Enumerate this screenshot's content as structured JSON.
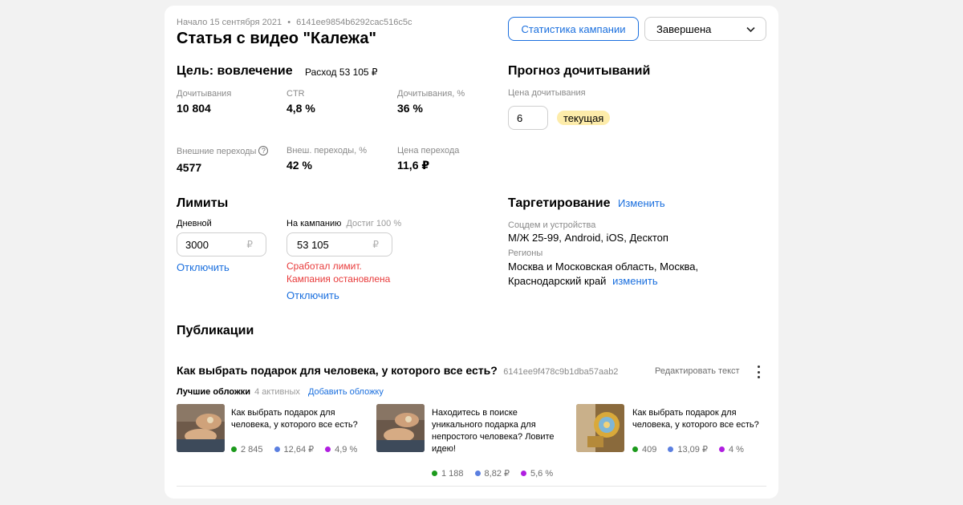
{
  "header": {
    "meta_date": "Начало 15 сентября 2021",
    "meta_sep": "•",
    "meta_id": "6141ee9854b6292cac516c5c",
    "title": "Статья с видео \"Калежа\"",
    "stats_button": "Статистика кампании",
    "status_select": "Завершена"
  },
  "goal": {
    "heading": "Цель: вовлечение",
    "expense": "Расход 53 105 ₽",
    "metrics": [
      {
        "label": "Дочитывания",
        "value": "10 804"
      },
      {
        "label": "CTR",
        "value": "4,8 %"
      },
      {
        "label": "Дочитывания, %",
        "value": "36 %"
      },
      {
        "label": "Внешние переходы",
        "value": "4577"
      },
      {
        "label": "Внеш. переходы, %",
        "value": "42 %"
      },
      {
        "label": "Цена перехода",
        "value": "11,6 ₽"
      }
    ]
  },
  "forecast": {
    "heading": "Прогноз дочитываний",
    "price_label": "Цена дочитывания",
    "price_value": "6",
    "badge": "текущая"
  },
  "limits": {
    "heading": "Лимиты",
    "daily_label": "Дневной",
    "daily_value": "3000",
    "currency": "₽",
    "daily_disable": "Отключить",
    "campaign_label": "На кампанию",
    "campaign_reached": "Достиг 100 %",
    "campaign_value": "53 105",
    "error_line1": "Сработал лимит.",
    "error_line2": "Кампания остановлена",
    "campaign_disable": "Отключить"
  },
  "targeting": {
    "heading": "Таргетирование",
    "change_link": "Изменить",
    "socdem_label": "Соцдем и устройства",
    "socdem_value": "М/Ж 25-99, Android, iOS, Десктоп",
    "regions_label": "Регионы",
    "regions_line1": "Москва и Московская область, Москва,",
    "regions_line2": "Краснодарский край",
    "regions_change": "изменить"
  },
  "publications": {
    "heading": "Публикации",
    "article_title": "Как выбрать подарок для человека, у которого все есть?",
    "article_id": "6141ee9f478c9b1dba57aab2",
    "edit_text": "Редактировать текст",
    "covers_label": "Лучшие обложки",
    "covers_count": "4 активных",
    "add_cover": "Добавить обложку",
    "items": [
      {
        "text": "Как выбрать подарок для человека, у которого все есть?",
        "views": "2 845",
        "price": "12,64 ₽",
        "ctr": "4,9 %"
      },
      {
        "text": "Находитесь в поиске уникального подарка для непростого человека? Ловите идею!",
        "views": "1 188",
        "price": "8,82 ₽",
        "ctr": "5,6 %"
      },
      {
        "text": "Как выбрать подарок для человека, у которого все есть?",
        "views": "409",
        "price": "13,09 ₽",
        "ctr": "4 %"
      }
    ]
  },
  "colors": {
    "accent": "#1a6fde",
    "error": "#e83a3a",
    "badge": "#fdecaa",
    "dot_green": "#1c9a1c",
    "dot_blue": "#5b7fe0",
    "dot_purple": "#b01ee0"
  }
}
